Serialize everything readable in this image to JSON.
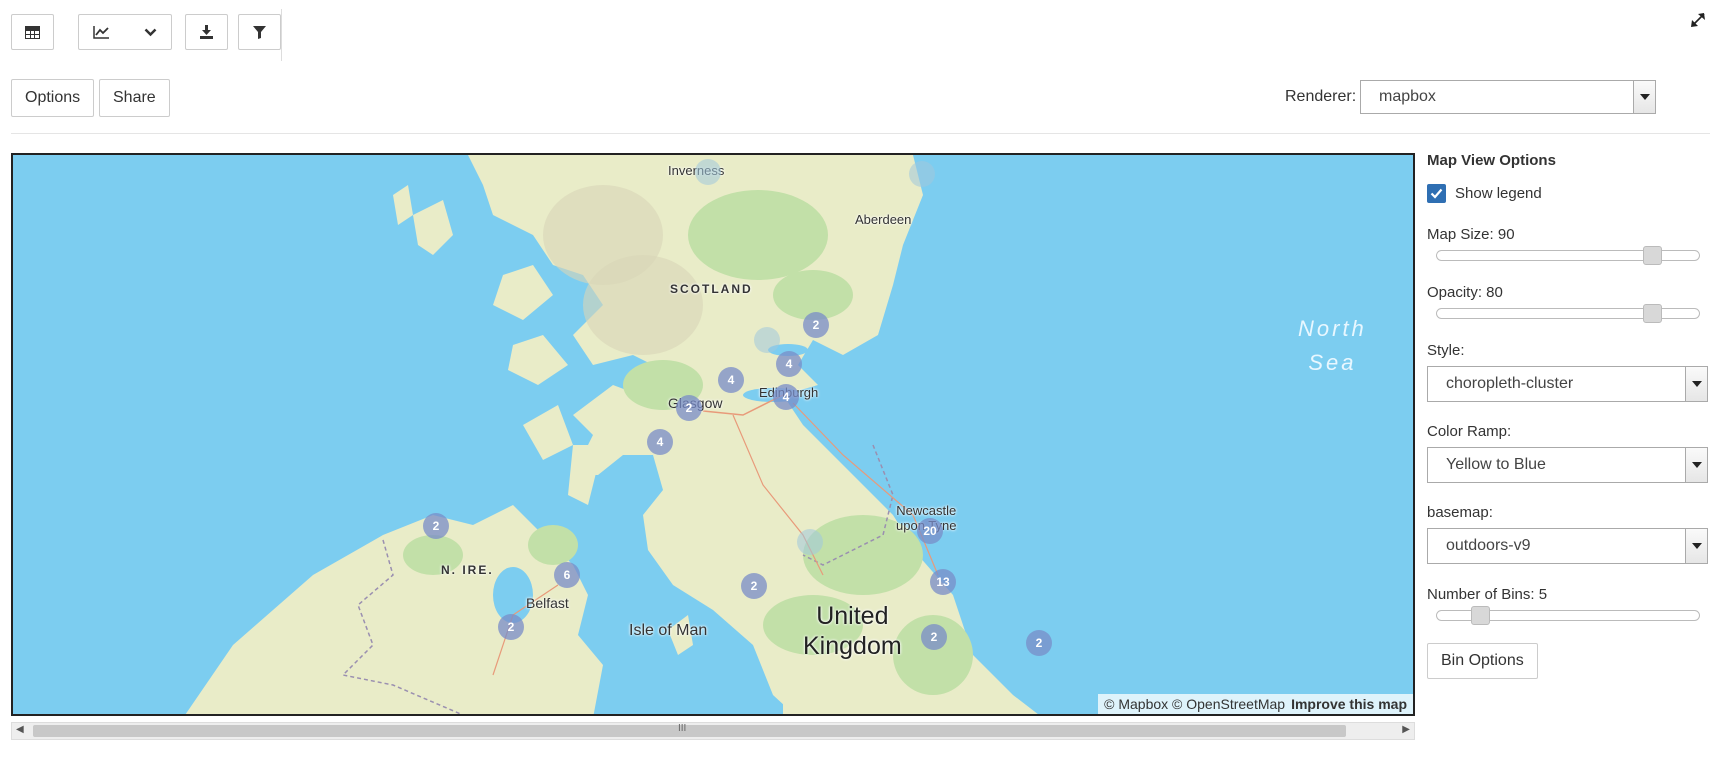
{
  "toolbar": {
    "table_icon": "table-icon",
    "chart_icon": "line-chart-icon",
    "dropdown_icon": "chevron-down-icon",
    "download_icon": "download-icon",
    "filter_icon": "filter-icon",
    "collapse_icon": "compress-icon"
  },
  "actions": {
    "options_label": "Options",
    "share_label": "Share"
  },
  "renderer": {
    "label": "Renderer:",
    "value": "mapbox"
  },
  "map": {
    "places": {
      "inverness": "Inverness",
      "aberdeen": "Aberdeen",
      "scotland": "SCOTLAND",
      "glasgow": "Glasgow",
      "edinburgh": "Edinburgh",
      "newcastle_line1": "Newcastle",
      "newcastle_line2": "upon Tyne",
      "n_ireland": "N. IRE.",
      "belfast": "Belfast",
      "isle_of_man": "Isle of Man",
      "uk_line1": "United",
      "uk_line2": "Kingdom",
      "north_sea_line1": "North",
      "north_sea_line2": "Sea"
    },
    "clusters": [
      "2",
      "4",
      "4",
      "2",
      "4",
      "4",
      "2",
      "20",
      "2",
      "13",
      "2",
      "2",
      "2",
      "6"
    ],
    "attribution": "© Mapbox © OpenStreetMap",
    "improve": "Improve this map",
    "colors": {
      "water": "#7ccdf0",
      "land": "#e9ecc8",
      "forest": "#c2e0a8",
      "cluster": "#7f8fc8"
    }
  },
  "sidebar": {
    "title": "Map View Options",
    "show_legend": "Show legend",
    "map_size_label": "Map Size: 90",
    "map_size_value": 90,
    "opacity_label": "Opacity: 80",
    "opacity_value": 80,
    "style_label": "Style:",
    "style_value": "choropleth-cluster",
    "color_ramp_label": "Color Ramp:",
    "color_ramp_value": "Yellow to Blue",
    "basemap_label": "basemap:",
    "basemap_value": "outdoors-v9",
    "bins_label": "Number of Bins: 5",
    "bins_value": 5,
    "bin_options_label": "Bin Options"
  },
  "scrollbar": {
    "left_arrow": "◀",
    "right_arrow": "▶",
    "grip": "III"
  }
}
